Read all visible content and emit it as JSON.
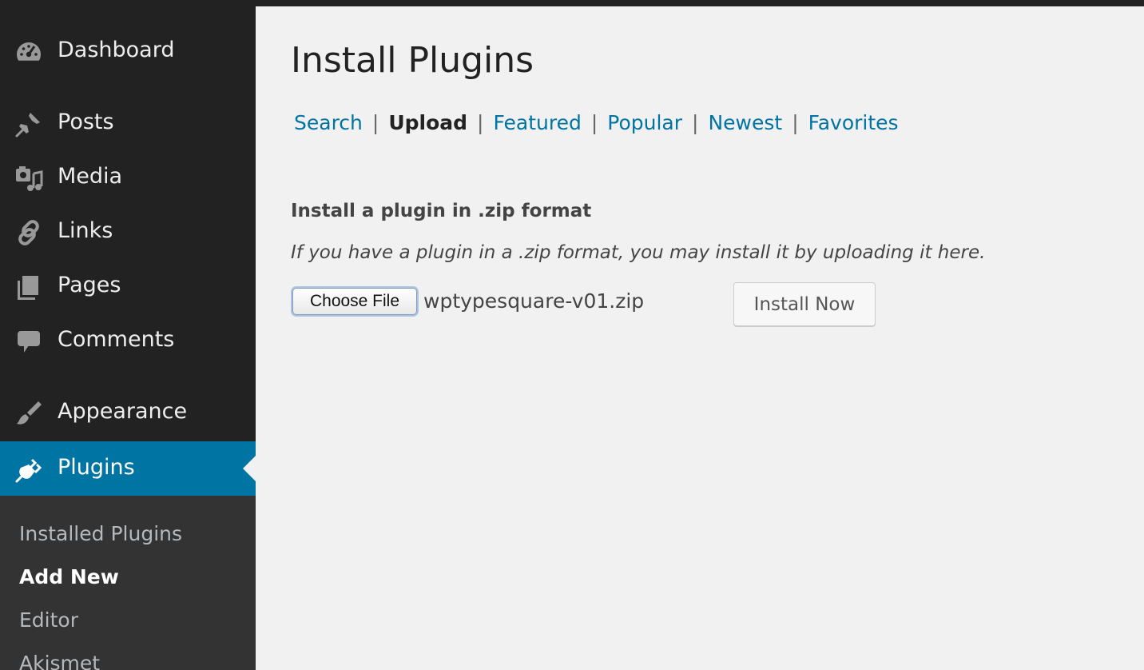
{
  "sidebar": {
    "items": [
      {
        "label": "Dashboard",
        "icon": "dashboard-icon"
      },
      {
        "label": "Posts",
        "icon": "pushpin-icon"
      },
      {
        "label": "Media",
        "icon": "media-icon"
      },
      {
        "label": "Links",
        "icon": "link-icon"
      },
      {
        "label": "Pages",
        "icon": "pages-icon"
      },
      {
        "label": "Comments",
        "icon": "comment-bubble-icon"
      },
      {
        "label": "Appearance",
        "icon": "paintbrush-icon"
      },
      {
        "label": "Plugins",
        "icon": "plug-icon",
        "active": true
      }
    ],
    "submenu": [
      {
        "label": "Installed Plugins"
      },
      {
        "label": "Add New",
        "current": true
      },
      {
        "label": "Editor"
      },
      {
        "label": "Akismet"
      }
    ]
  },
  "main": {
    "title": "Install Plugins",
    "tabs": [
      {
        "label": "Search"
      },
      {
        "label": "Upload",
        "current": true
      },
      {
        "label": "Featured"
      },
      {
        "label": "Popular"
      },
      {
        "label": "Newest"
      },
      {
        "label": "Favorites"
      }
    ],
    "separator": "|",
    "upload": {
      "heading": "Install a plugin in .zip format",
      "description": "If you have a plugin in a .zip format, you may install it by uploading it here.",
      "choose_file_label": "Choose File",
      "file_name": "wptypesquare-v01.zip",
      "install_label": "Install Now"
    }
  },
  "colors": {
    "sidebar_bg": "#222222",
    "submenu_bg": "#333333",
    "accent": "#0074a2",
    "page_bg": "#f1f1f1",
    "link": "#0074a2"
  }
}
